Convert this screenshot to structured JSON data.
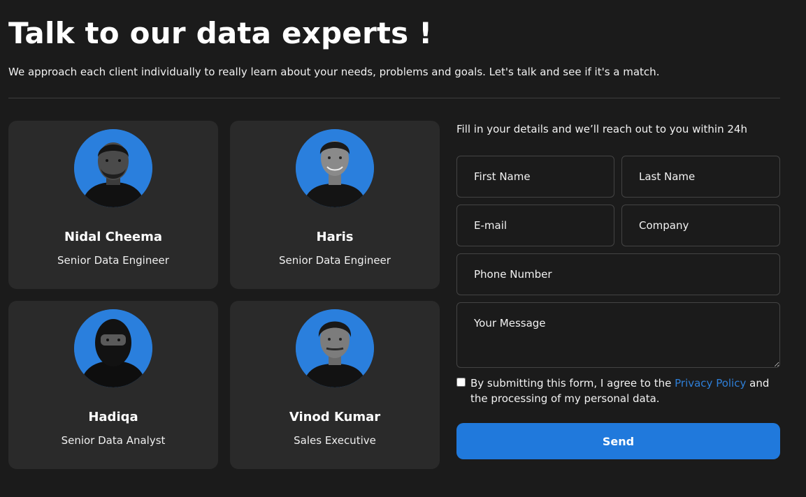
{
  "header": {
    "title": "Talk to our data experts !",
    "subtitle": "We approach each client individually to really learn about your needs, problems and goals. Let's talk and see if it's a match."
  },
  "team": [
    {
      "name": "Nidal Cheema",
      "role": "Senior Data Engineer",
      "photo": "profile-photo"
    },
    {
      "name": "Haris",
      "role": "Senior Data Engineer",
      "photo": "profile-photo"
    },
    {
      "name": "Hadiqa",
      "role": "Senior Data Analyst",
      "photo": "profile-photo"
    },
    {
      "name": "Vinod Kumar",
      "role": "Sales Executive",
      "photo": "profile-photo"
    }
  ],
  "form": {
    "intro": "Fill in your details and we’ll reach out to you within 24h",
    "first_name": {
      "placeholder": "First Name",
      "value": ""
    },
    "last_name": {
      "placeholder": "Last Name",
      "value": ""
    },
    "email": {
      "placeholder": "E-mail",
      "value": ""
    },
    "company": {
      "placeholder": "Company",
      "value": ""
    },
    "phone": {
      "placeholder": "Phone Number",
      "value": ""
    },
    "message": {
      "placeholder": "Your Message",
      "value": ""
    },
    "consent": {
      "checked": false,
      "text_before": "By submitting this form, I agree to the ",
      "link": "Privacy Policy",
      "text_after": " and the processing of my personal data."
    },
    "send_label": "Send"
  },
  "colors": {
    "background": "#1b1b1b",
    "card": "#2a2a2a",
    "accent": "#2079dc",
    "link": "#2e7fd8"
  }
}
